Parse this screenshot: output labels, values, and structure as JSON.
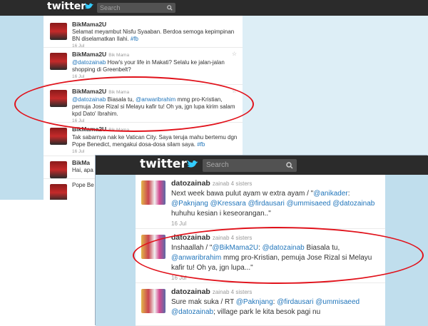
{
  "brand": {
    "name": "twitter"
  },
  "colors": {
    "accent": "#e1121b",
    "link": "#2276bb",
    "topbar": "#2b2b2b",
    "page_bg": "#c0deed"
  },
  "search": {
    "placeholder": "Search"
  },
  "timeline_back": {
    "tweets": [
      {
        "user": "BikMama2U",
        "subtitle": "",
        "segments": [
          {
            "t": "Selamat meyambut Nisfu Syaaban. Berdoa semoga kepimpinan BN diselamatkan Ilahi. ",
            "link": false
          },
          {
            "t": "#fb",
            "link": true
          }
        ],
        "date": "16 Jul"
      },
      {
        "user": "BikMama2U",
        "subtitle": "Bik Mama",
        "segments": [
          {
            "t": "@datozainab",
            "link": true
          },
          {
            "t": " How's your life in Makati? Selalu ke jalan-jalan shopping di Greenbelt?",
            "link": false
          }
        ],
        "date": "16 Jul"
      },
      {
        "user": "BikMama2U",
        "subtitle": "Bik Mama",
        "segments": [
          {
            "t": "@datozainab",
            "link": true
          },
          {
            "t": " Biasala tu, ",
            "link": false
          },
          {
            "t": "@anwaribrahim",
            "link": true
          },
          {
            "t": " mmg pro-Kristian, pemuja Jose Rizal si Melayu kafir tu! Oh ya, jgn lupa kirim salam kpd Dato' Ibrahim.",
            "link": false
          }
        ],
        "date": "16 Jul"
      },
      {
        "user": "BikMama2U",
        "subtitle": "Bik Mama",
        "segments": [
          {
            "t": "Tak sabarnya nak ke Vatican City. Saya teruja mahu bertemu dgn Pope Benedict, mengakui dosa-dosa silam saya. ",
            "link": false
          },
          {
            "t": "#fb",
            "link": true
          }
        ],
        "date": "16 Jul"
      },
      {
        "user": "BikMa",
        "subtitle": "",
        "segments": [
          {
            "t": "Hai, apa",
            "link": false
          }
        ],
        "date": ""
      },
      {
        "user": "",
        "subtitle": "",
        "segments": [
          {
            "t": "Pope Be",
            "link": false
          }
        ],
        "date": ""
      }
    ]
  },
  "timeline_front": {
    "tweets": [
      {
        "user": "datozainab",
        "subtitle": "zainab 4 sisters",
        "segments": [
          {
            "t": "Next week bawa pulut ayam w extra ayam / \"",
            "link": false
          },
          {
            "t": "@anikader",
            "link": true
          },
          {
            "t": ": ",
            "link": false
          },
          {
            "t": "@Paknjang",
            "link": true
          },
          {
            "t": " ",
            "link": false
          },
          {
            "t": "@Kressara",
            "link": true
          },
          {
            "t": " ",
            "link": false
          },
          {
            "t": "@firdausari",
            "link": true
          },
          {
            "t": " ",
            "link": false
          },
          {
            "t": "@ummisaeed",
            "link": true
          },
          {
            "t": " ",
            "link": false
          },
          {
            "t": "@datozainab",
            "link": true
          },
          {
            "t": " huhuhu kesian i keseorangan..\"",
            "link": false
          }
        ],
        "date": "16 Jul"
      },
      {
        "user": "datozainab",
        "subtitle": "zainab 4 sisters",
        "segments": [
          {
            "t": "Inshaallah / \"",
            "link": false
          },
          {
            "t": "@BikMama2U",
            "link": true
          },
          {
            "t": ": ",
            "link": false
          },
          {
            "t": "@datozainab",
            "link": true
          },
          {
            "t": " Biasala tu, ",
            "link": false
          },
          {
            "t": "@anwaribrahim",
            "link": true
          },
          {
            "t": " mmg pro-Kristian, pemuja Jose Rizal si Melayu kafir tu! Oh ya, jgn lupa...\"",
            "link": false
          }
        ],
        "date": "16 Jul"
      },
      {
        "user": "datozainab",
        "subtitle": "zainab 4 sisters",
        "segments": [
          {
            "t": "Sure mak suka / RT ",
            "link": false
          },
          {
            "t": "@Paknjang",
            "link": true
          },
          {
            "t": ": ",
            "link": false
          },
          {
            "t": "@firdausari",
            "link": true
          },
          {
            "t": " ",
            "link": false
          },
          {
            "t": "@ummisaeed",
            "link": true
          },
          {
            "t": " ",
            "link": false
          },
          {
            "t": "@datozainab",
            "link": true
          },
          {
            "t": "; village park le kita besok pagi nu",
            "link": false
          }
        ],
        "date": ""
      }
    ]
  }
}
